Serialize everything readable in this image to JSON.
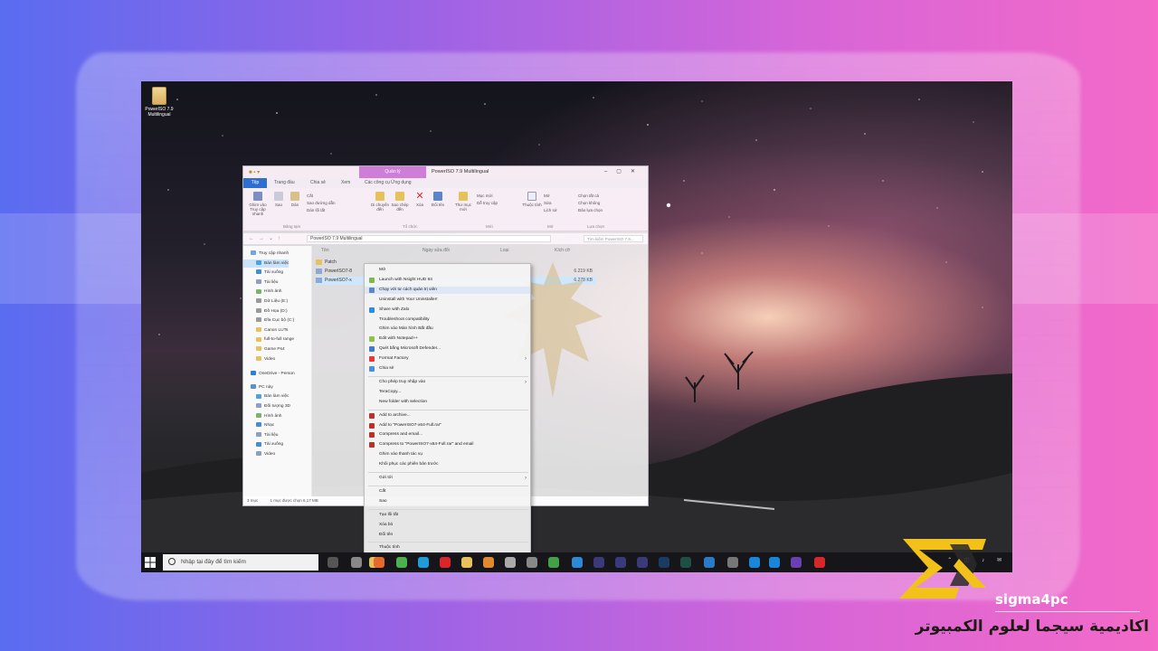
{
  "desktop": {
    "icon_label": "PowerISO 7.9 Multilingual"
  },
  "explorer": {
    "title": "PowerISO 7.9 Multilingual",
    "context_tab": "Quản lý",
    "tabs": [
      "Tệp",
      "Trang đầu",
      "Chia sẻ",
      "Xem",
      "Các công cụ Ứng dụng"
    ],
    "ribbon": {
      "pin": "Ghim vào Truy cập nhanh",
      "copy": "Sao",
      "paste": "Dán",
      "cut": "Cắt",
      "copy_path": "Sao đường dẫn",
      "paste_shortcut": "Dán lối tắt",
      "move_to": "Di chuyển đến",
      "copy_to": "Sao chép đến",
      "delete": "Xóa",
      "rename": "Đổi tên",
      "new_folder": "Thư mục mới",
      "new_item": "Mục mới",
      "easy_access": "Dễ truy cập",
      "properties": "Thuộc tính",
      "open": "Mở",
      "edit": "Sửa",
      "history": "Lịch sử",
      "select_all": "Chọn tất cả",
      "select_none": "Chọn không",
      "invert": "Đảo lựa chọn",
      "group_clipboard": "Bảng tạm",
      "group_organize": "Tổ chức",
      "group_new": "Mới",
      "group_open": "Mở",
      "group_select": "Lựa chọn"
    },
    "address": "PowerISO 7.9 Multilingual",
    "search_placeholder": "Tìm kiếm PowerISO 7.9...",
    "columns": [
      "Tên",
      "Ngày sửa đổi",
      "Loại",
      "Kích cỡ"
    ],
    "files": [
      {
        "name": "Patch",
        "size": ""
      },
      {
        "name": "PowerISO7-8",
        "size": "6.219 KB"
      },
      {
        "name": "PowerISO7-x",
        "size": "6.278 KB"
      }
    ],
    "nav": [
      "Truy cập nhanh",
      "Bàn làm việc",
      "Tải xuống",
      "Tài liệu",
      "Hình ảnh",
      "Dữ Liệu (E:)",
      "Đồ Họa (D:)",
      "Đĩa Cục bộ (C:)",
      "Canon LUTs",
      "full-to-full range",
      "Game Ps4",
      "Video",
      "OneDrive - Person",
      "PC này",
      "Bàn làm việc",
      "Đối tượng 3D",
      "Hình ảnh",
      "Nhạc",
      "Tài liệu",
      "Tải xuống",
      "Video"
    ],
    "status": [
      "3 mục",
      "1 mục được chọn  6,17 MB"
    ]
  },
  "context_menu": {
    "items": [
      "Mở",
      "Launch with Nsight HUD 64",
      "Chạy với tư cách quản trị viên",
      "Uninstall with Your Uninstaller!",
      "Share with Zalo",
      "Troubleshoot compatibility",
      "Ghim vào Màn hình Bắt đầu",
      "Edit with Notepad++",
      "Quét bằng Microsoft Defender...",
      "Format Factory",
      "Chia sẻ",
      "Cho phép truy nhập vào",
      "TeraCopy...",
      "New folder with selection",
      "Add to archive...",
      "Add to \"PowerISO7-x64-Full.rar\"",
      "Compress and email...",
      "Compress to \"PowerISO7-x64-Full.rar\" and email",
      "Ghim vào thanh tác vụ",
      "Khôi phục các phiên bản trước",
      "Gửi tới",
      "Cắt",
      "Sao",
      "Tạo lối tắt",
      "Xóa bỏ",
      "Đổi tên",
      "Thuộc tính"
    ]
  },
  "taskbar": {
    "search_placeholder": "Nhập tại đây để tìm kiếm"
  },
  "branding": {
    "site": "sigma4pc",
    "arabic": "اكاديمية سيجما لعلوم الكمبيوتر",
    "accent": "#f3c21a"
  }
}
